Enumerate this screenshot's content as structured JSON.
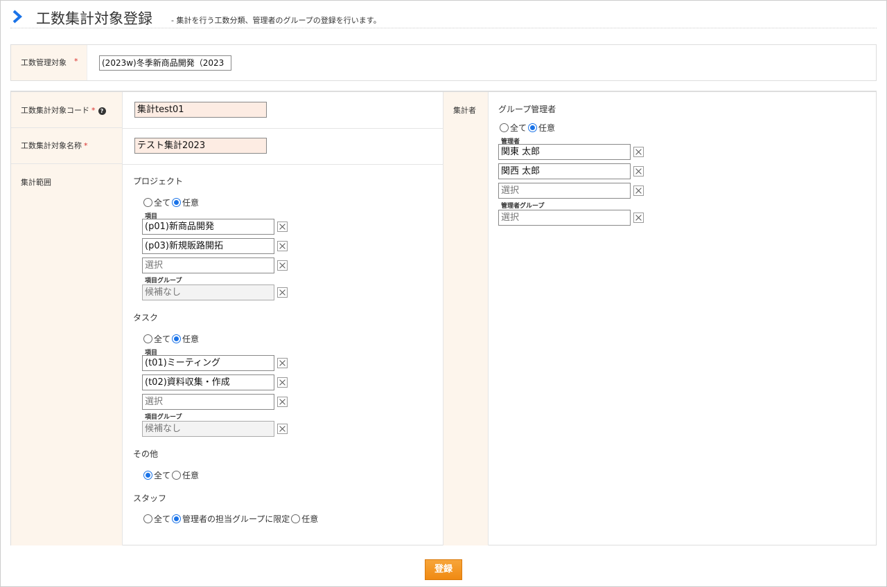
{
  "header": {
    "title": "工数集計対象登録",
    "subtitle": "- 集計を行う工数分類、管理者のグループの登録を行います。"
  },
  "target": {
    "label": "工数管理対象",
    "value": "(2023w)冬季新商品開発（2023"
  },
  "code": {
    "label": "工数集計対象コード",
    "value": "集計test01"
  },
  "name": {
    "label": "工数集計対象名称",
    "value": "テスト集計2023"
  },
  "range": {
    "label": "集計範囲",
    "project": {
      "title": "プロジェクト",
      "radio_all": "全て",
      "radio_any": "任意",
      "items_label": "項目",
      "items": [
        "(p01)新商品開発",
        "(p03)新規販路開拓"
      ],
      "select_placeholder": "選択",
      "group_label": "項目グループ",
      "group_placeholder": "候補なし"
    },
    "task": {
      "title": "タスク",
      "radio_all": "全て",
      "radio_any": "任意",
      "items_label": "項目",
      "items": [
        "(t01)ミーティング",
        "(t02)資料収集・作成"
      ],
      "select_placeholder": "選択",
      "group_label": "項目グループ",
      "group_placeholder": "候補なし"
    },
    "other": {
      "title": "その他",
      "radio_all": "全て",
      "radio_any": "任意"
    },
    "staff": {
      "title": "スタッフ",
      "radio_all": "全て",
      "radio_group": "管理者の担当グループに限定",
      "radio_any": "任意"
    }
  },
  "aggregator": {
    "label": "集計者",
    "title": "グループ管理者",
    "radio_all": "全て",
    "radio_any": "任意",
    "managers_label": "管理者",
    "managers": [
      "関東 太郎",
      "関西 太郎"
    ],
    "select_placeholder": "選択",
    "group_label": "管理者グループ",
    "group_placeholder": "選択"
  },
  "submit_label": "登録",
  "colors": {
    "accent": "#1a73e8",
    "button": "#f08a12",
    "label_bg": "#fdf5ec",
    "required": "#d9302c"
  }
}
